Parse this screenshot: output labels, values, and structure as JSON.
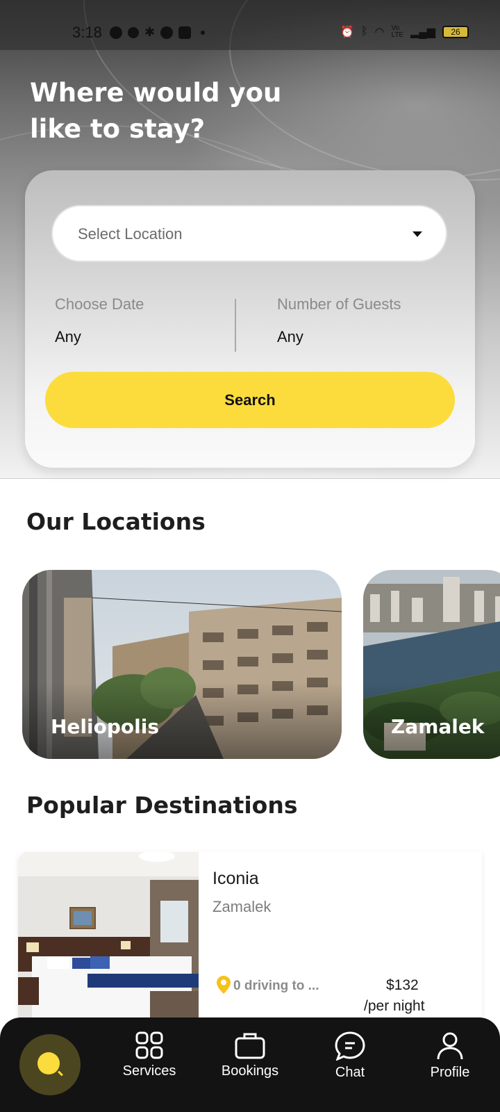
{
  "status_bar": {
    "time": "3:18",
    "battery": "26"
  },
  "hero": {
    "title": "Where would you like to stay?"
  },
  "search": {
    "location_placeholder": "Select Location",
    "date_label": "Choose Date",
    "date_value": "Any",
    "guests_label": "Number of Guests",
    "guests_value": "Any",
    "button_label": "Search"
  },
  "our_locations": {
    "title": "Our Locations",
    "items": [
      {
        "name": "Heliopolis"
      },
      {
        "name": "Zamalek"
      }
    ]
  },
  "popular": {
    "title": "Popular Destinations",
    "items": [
      {
        "name": "Iconia",
        "area": "Zamalek",
        "distance": "0 driving to ...",
        "price": "$132",
        "per": "/per night"
      }
    ]
  },
  "nav": {
    "items": [
      {
        "label": "Services",
        "icon": "grid-icon"
      },
      {
        "label": "Bookings",
        "icon": "briefcase-icon"
      },
      {
        "label": "Chat",
        "icon": "chat-bubble-icon"
      },
      {
        "label": "Profile",
        "icon": "person-icon"
      }
    ]
  },
  "colors": {
    "accent": "#fcdc3d",
    "nav_background": "#131314",
    "pin": "#f6c21b"
  }
}
